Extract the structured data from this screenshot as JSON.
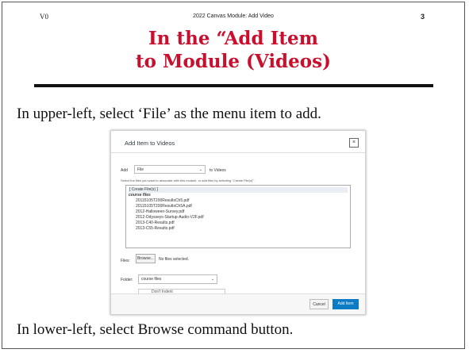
{
  "header": {
    "left": "V0",
    "center": "2022 Canvas Module: Add Video",
    "page_number": "3"
  },
  "title_lines": [
    "In the “Add Item",
    "to Module (Videos)"
  ],
  "paragraphs": {
    "first": "In upper-left, select ‘File’ as the menu item to add.",
    "second": "In lower-left, select Browse command button."
  },
  "dialog": {
    "title": "Add Item to Videos",
    "close_glyph": "×",
    "add_label": "Add",
    "add_select_value": "File",
    "add_suffix": "to Videos",
    "instructions": "Select the files you want to associate with this module, or add files by selecting \"Create File(s)\".",
    "create_option": "[ Create File(s) ]",
    "folder_option": "course files",
    "files": [
      "20115105T200ResultsCh5.pdf",
      "20115105T200ResultsCh5A.pdf",
      "2012-Halloween-Survey.pdf",
      "2012-Odysseys-Startup-Audio-V2F.pdf",
      "2013-C40-Results.pdf",
      "2013-C55-Results.pdf"
    ],
    "files_label": "Files:",
    "browse_label": "Browse...",
    "no_file_text": "No files selected.",
    "folder_label": "Folder:",
    "folder_select_value": "course files",
    "partial_select_value": "Don't Indent",
    "cancel_label": "Cancel",
    "add_item_label": "Add Item"
  }
}
